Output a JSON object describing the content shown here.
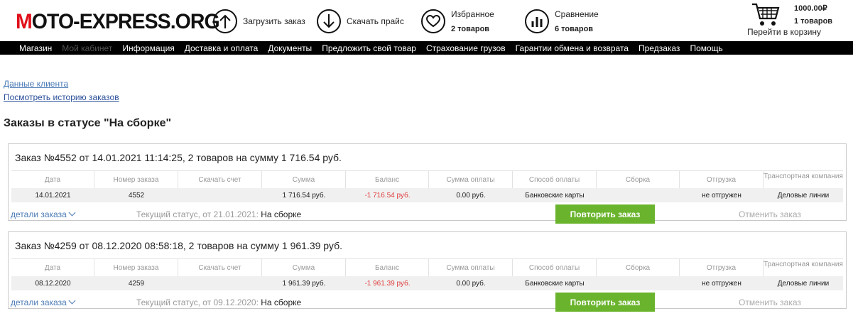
{
  "header": {
    "logo": {
      "prefix": "M",
      "rest": "OTO-EXPRESS.ORG"
    },
    "upload": "Загрузить заказ",
    "download": "Скачать прайс",
    "favorites": {
      "label": "Избранное",
      "count": "2 товаров"
    },
    "compare": {
      "label": "Сравнение",
      "count": "6 товаров"
    },
    "cart": {
      "sum": "1000.00₽",
      "count": "1 товаров",
      "link": "Перейти в корзину"
    }
  },
  "nav": [
    "Магазин",
    "Мой кабинет",
    "Информация",
    "Доставка и оплата",
    "Документы",
    "Предложить свой товар",
    "Страхование грузов",
    "Гарантии обмена и возврата",
    "Предзаказ",
    "Помощь"
  ],
  "links": {
    "client": "Данные клиента",
    "history": "Посмотреть историю заказов"
  },
  "section_title": "Заказы в статусе \"На сборке\"",
  "columns": [
    "Дата",
    "Номер заказа",
    "Скачать счет",
    "Сумма",
    "Баланс",
    "Сумма оплаты",
    "Способ оплаты",
    "Сборка",
    "Отгрузка",
    "Транспортная компания"
  ],
  "orders": [
    {
      "title": "Заказ №4552 от 14.01.2021 11:14:25, 2 товаров на сумму 1 716.54 руб.",
      "row": [
        "14.01.2021",
        "4552",
        "",
        "1 716.54 руб.",
        "-1 716.54 руб.",
        "0.00 руб.",
        "Банковские карты",
        "",
        "не отгружен",
        "Деловые линии"
      ],
      "details": "детали заказа",
      "status_prefix": "Текущий статус, от 21.01.2021:",
      "status": "На сборке",
      "repeat": "Повторить заказ",
      "cancel": "Отменить заказ"
    },
    {
      "title": "Заказ №4259 от 08.12.2020 08:58:18, 2 товаров на сумму 1 961.39 руб.",
      "row": [
        "08.12.2020",
        "4259",
        "",
        "1 961.39 руб.",
        "-1 961.39 руб.",
        "0.00 руб.",
        "Банковские карты",
        "",
        "не отгружен",
        "Деловые линии"
      ],
      "details": "детали заказа",
      "status_prefix": "Текущий статус, от 09.12.2020:",
      "status": "На сборке",
      "repeat": "Повторить заказ",
      "cancel": "Отменить заказ"
    }
  ]
}
